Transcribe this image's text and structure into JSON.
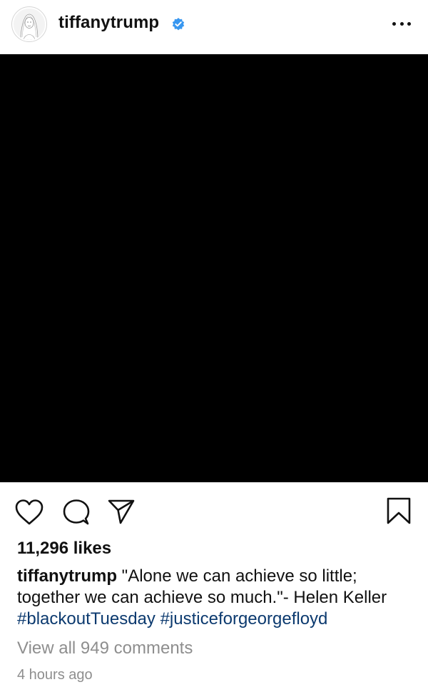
{
  "header": {
    "username": "tiffanytrump",
    "verified_icon": "verified-badge-icon",
    "more_icon": "more-options-icon"
  },
  "post": {
    "image_color": "#000000"
  },
  "actions": {
    "icons": [
      "heart-icon",
      "comment-icon",
      "share-icon",
      "bookmark-icon"
    ]
  },
  "likes": "11,296 likes",
  "caption": {
    "username": "tiffanytrump",
    "text": "\"Alone we can achieve so little; together we can achieve so much.\"- Helen Keller",
    "hashtags": [
      "#blackoutTuesday",
      "#justiceforgeorgefloyd"
    ]
  },
  "comments_link": "View all 949 comments",
  "timestamp": "4 hours ago",
  "colors": {
    "verified": "#3897f0",
    "hashtag": "#0c3a6f",
    "muted": "#8e8e8e"
  }
}
